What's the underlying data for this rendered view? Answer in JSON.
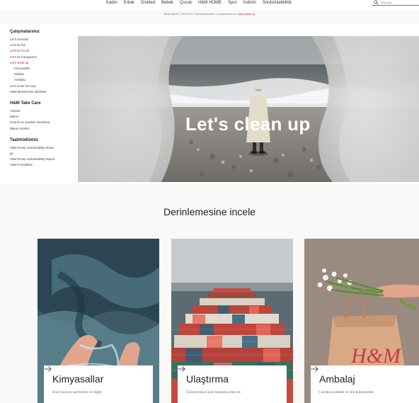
{
  "nav": {
    "items": [
      "Kadın",
      "Erkek",
      "Divided",
      "Bebek",
      "Çocuk",
      "H&M HOME",
      "Spor",
      "İndirim",
      "Sürdürülebilirlik"
    ],
    "search_placeholder": "Ürün ara",
    "search_icon": "search-icon"
  },
  "breadcrumb": {
    "home": "BAŞLANGIÇ SAYFASI",
    "sep1": " / ",
    "sustainability": "Sürdürülebilirlik",
    "sep2": " / ",
    "our_work": "Çalışmalarımız",
    "sep3": " / ",
    "current": "Let's clean up"
  },
  "sidebar": {
    "sections": [
      {
        "title": "Çalışmalarımız",
        "items": [
          {
            "label": "Let's innovate",
            "active": false,
            "sub": false
          },
          {
            "label": "Let's be fair",
            "active": false,
            "sub": false
          },
          {
            "label": "Let's be for all",
            "active": false,
            "sub": false
          },
          {
            "label": "Let's be transparent",
            "active": false,
            "sub": false
          },
          {
            "label": "Let's clean up",
            "active": true,
            "sub": false
          },
          {
            "label": "Kimyasallar",
            "active": false,
            "sub": true
          },
          {
            "label": "Nakliye",
            "active": false,
            "sub": true
          },
          {
            "label": "Ambalaj",
            "active": false,
            "sub": true
          },
          {
            "label": "Let's close the loop",
            "active": false,
            "sub": false
          },
          {
            "label": "H&M Member'ları dahilinde",
            "active": false,
            "sub": false
          }
        ]
      },
      {
        "title": "H&M Take Care",
        "items": [
          {
            "label": "Yıkama",
            "active": false,
            "sub": false
          },
          {
            "label": "Bakım",
            "active": false,
            "sub": false
          },
          {
            "label": "Onarım ve yeniden tasarlama",
            "active": false,
            "sub": false
          },
          {
            "label": "Bakım ürünleri",
            "active": false,
            "sub": false
          }
        ]
      },
      {
        "title": "Taahhüdümüz",
        "items": [
          {
            "label": "H&M Group Sustainability Strate",
            "active": false,
            "sub": false
          },
          {
            "label": "gy",
            "active": false,
            "sub": false
          },
          {
            "label": "H&M Group Sustainability Report",
            "active": false,
            "sub": false
          },
          {
            "label": "H&M Foundation",
            "active": false,
            "sub": false
          }
        ]
      }
    ]
  },
  "hero": {
    "title": "Let's clean up"
  },
  "deep_dive": {
    "title": "Derinlemesine incele",
    "cards": [
      {
        "title": "Kimyasallar",
        "desc": "Sinir bozucu pestisitler ve diğer",
        "arrow_icon": "arrow-right-icon"
      },
      {
        "title": "Ulaştırma",
        "desc": "Ürünlerimizi size mümkün olan en",
        "arrow_icon": "arrow-right-icon"
      },
      {
        "title": "Ambalaj",
        "desc": "Gereksiz plastik ve tek kullanımlık",
        "arrow_icon": "arrow-right-icon"
      }
    ]
  },
  "colors": {
    "accent_red": "#d0021b",
    "background": "#faf9f8"
  }
}
